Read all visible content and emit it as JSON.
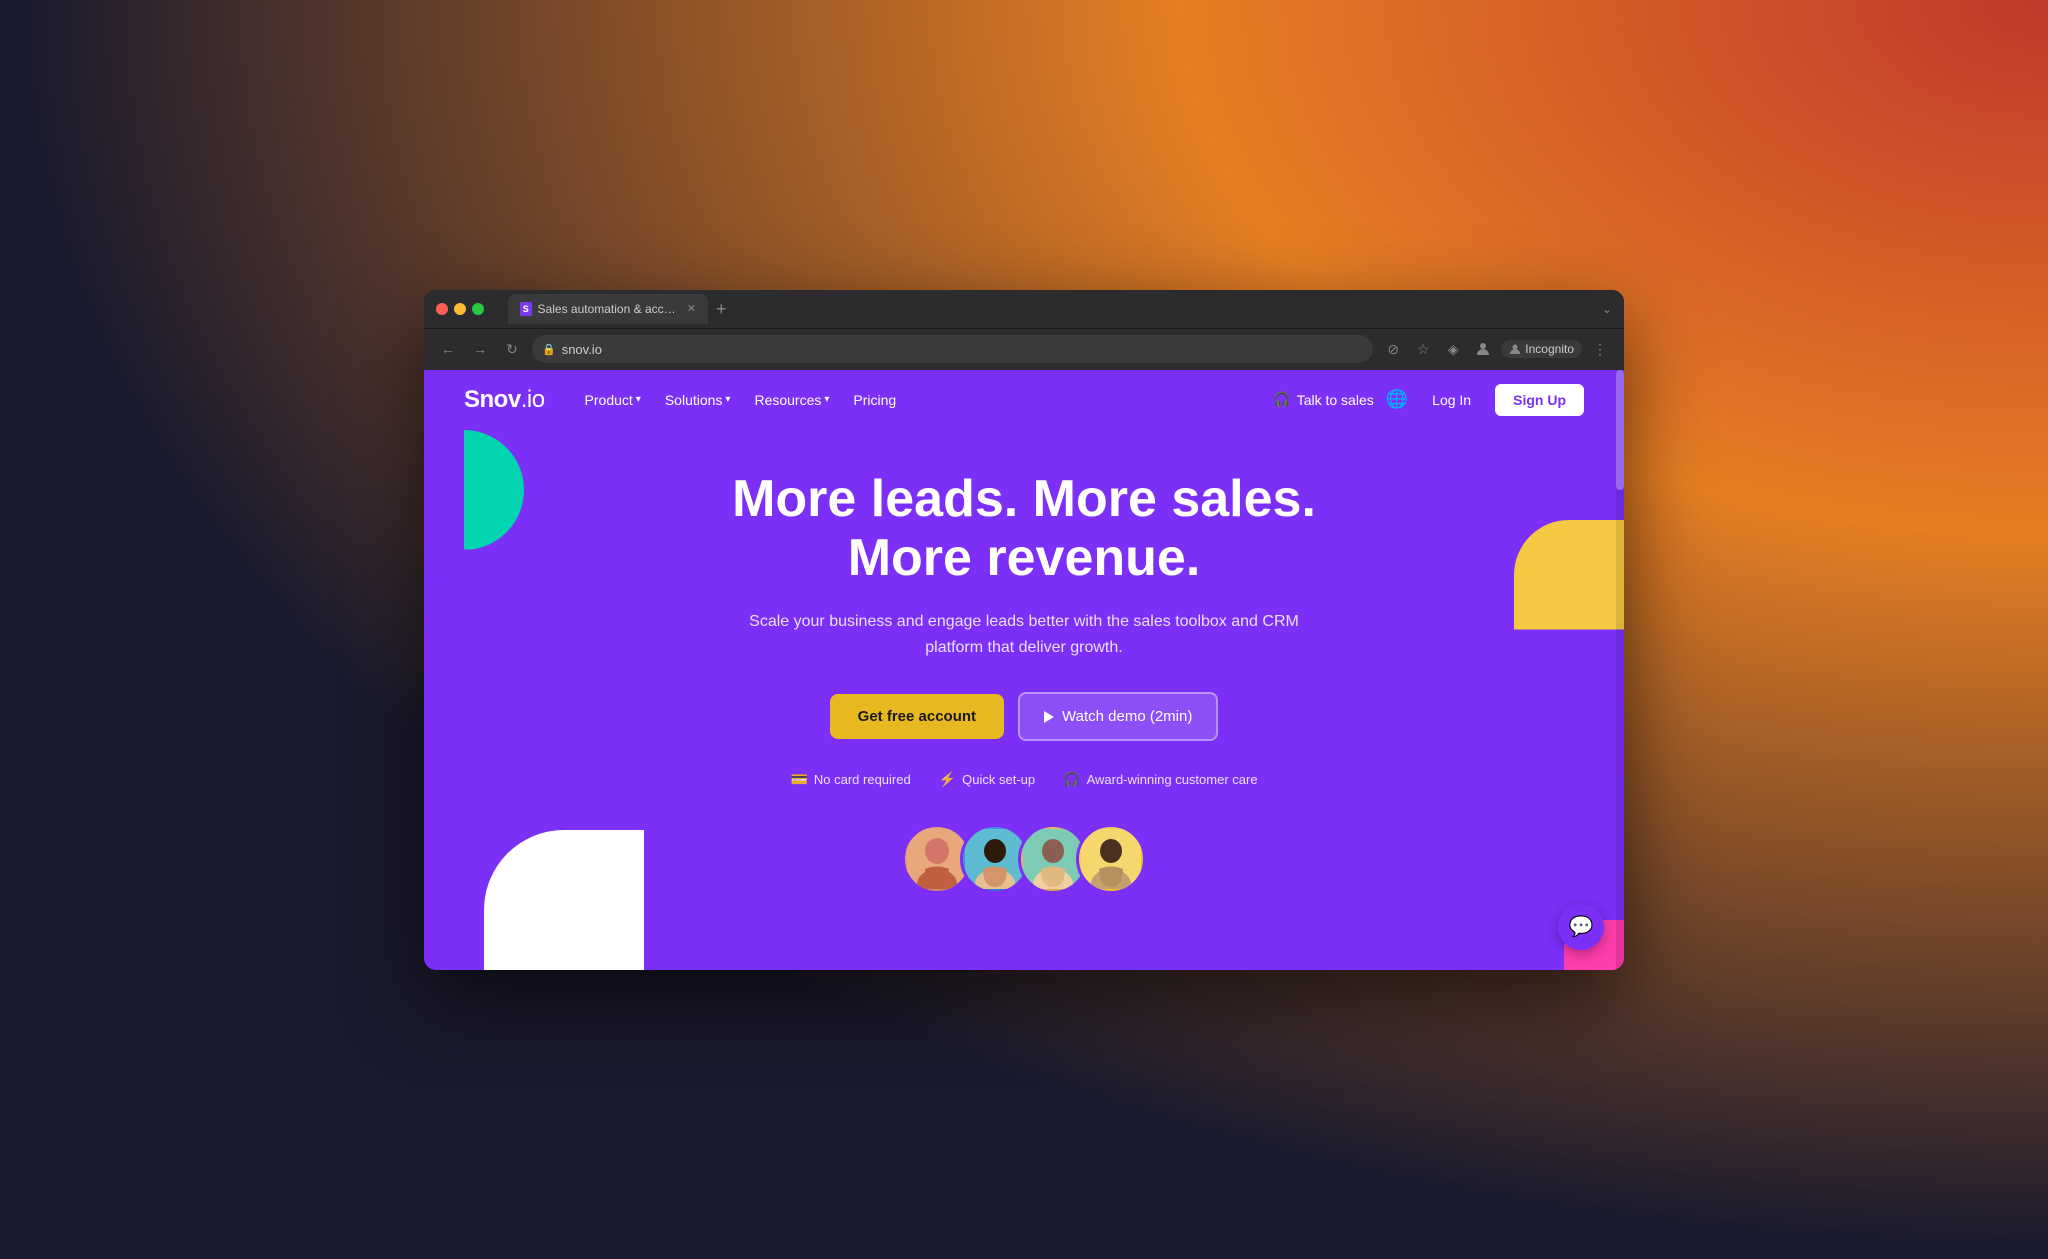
{
  "browser": {
    "tab_favicon": "S",
    "tab_title": "Sales automation & accelerati...",
    "url": "snov.io",
    "incognito_label": "Incognito"
  },
  "nav": {
    "logo_bold": "Snov",
    "logo_light": ".io",
    "product": "Product",
    "solutions": "Solutions",
    "resources": "Resources",
    "pricing": "Pricing",
    "talk_to_sales": "Talk to sales",
    "log_in": "Log In",
    "sign_up": "Sign Up"
  },
  "hero": {
    "title_line1": "More leads. More sales.",
    "title_line2": "More revenue.",
    "subtitle": "Scale your business and engage leads better with the sales toolbox and CRM platform that deliver growth.",
    "cta_primary": "Get free account",
    "cta_secondary": "Watch demo (2min)",
    "feature_1": "No card required",
    "feature_2": "Quick set-up",
    "feature_3": "Award-winning customer care"
  },
  "colors": {
    "purple": "#7b2ff7",
    "teal": "#00d4b1",
    "yellow": "#e8b820",
    "white": "#ffffff",
    "pink": "#ff3cac"
  }
}
